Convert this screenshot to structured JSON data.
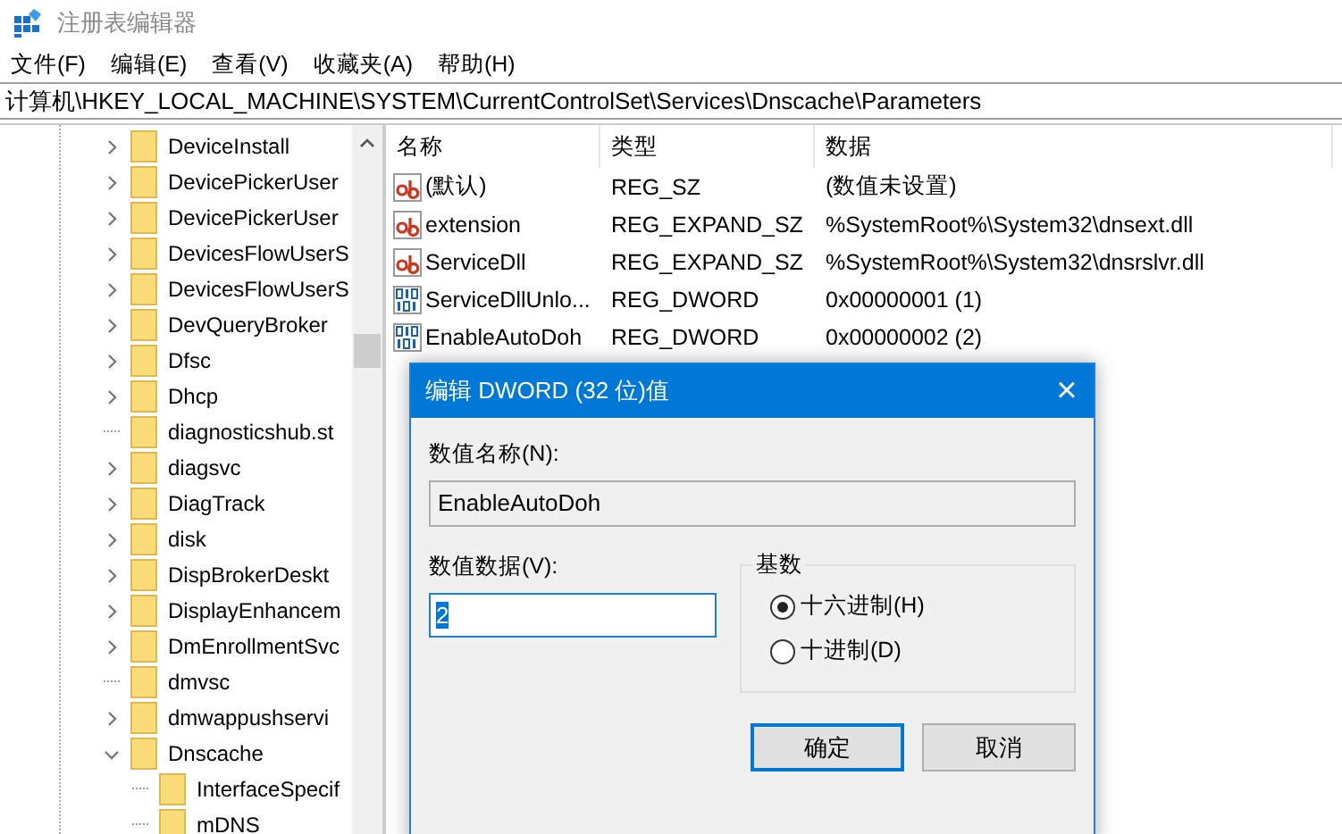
{
  "window": {
    "title": "注册表编辑器"
  },
  "menu": [
    "文件(F)",
    "编辑(E)",
    "查看(V)",
    "收藏夹(A)",
    "帮助(H)"
  ],
  "address": "计算机\\HKEY_LOCAL_MACHINE\\SYSTEM\\CurrentControlSet\\Services\\Dnscache\\Parameters",
  "tree": [
    {
      "label": "DeviceInstall",
      "expandable": true,
      "expanded": false
    },
    {
      "label": "DevicePickerUser",
      "expandable": true,
      "expanded": false
    },
    {
      "label": "DevicePickerUser",
      "expandable": true,
      "expanded": false
    },
    {
      "label": "DevicesFlowUserS",
      "expandable": true,
      "expanded": false
    },
    {
      "label": "DevicesFlowUserS",
      "expandable": true,
      "expanded": false
    },
    {
      "label": "DevQueryBroker",
      "expandable": true,
      "expanded": false
    },
    {
      "label": "Dfsc",
      "expandable": true,
      "expanded": false
    },
    {
      "label": "Dhcp",
      "expandable": true,
      "expanded": false
    },
    {
      "label": "diagnosticshub.st",
      "expandable": false,
      "expanded": false
    },
    {
      "label": "diagsvc",
      "expandable": true,
      "expanded": false
    },
    {
      "label": "DiagTrack",
      "expandable": true,
      "expanded": false
    },
    {
      "label": "disk",
      "expandable": true,
      "expanded": false
    },
    {
      "label": "DispBrokerDeskt",
      "expandable": true,
      "expanded": false
    },
    {
      "label": "DisplayEnhancem",
      "expandable": true,
      "expanded": false
    },
    {
      "label": "DmEnrollmentSvc",
      "expandable": true,
      "expanded": false
    },
    {
      "label": "dmvsc",
      "expandable": false,
      "expanded": false
    },
    {
      "label": "dmwappushservi",
      "expandable": true,
      "expanded": false
    },
    {
      "label": "Dnscache",
      "expandable": true,
      "expanded": true,
      "children": [
        {
          "label": "InterfaceSpecif",
          "expandable": false,
          "expanded": false
        },
        {
          "label": "mDNS",
          "expandable": false,
          "expanded": false
        }
      ]
    }
  ],
  "table": {
    "columns": [
      "名称",
      "类型",
      "数据"
    ],
    "rows": [
      {
        "kind": "string",
        "name": "(默认)",
        "type": "REG_SZ",
        "data": "(数值未设置)"
      },
      {
        "kind": "string",
        "name": "extension",
        "type": "REG_EXPAND_SZ",
        "data": "%SystemRoot%\\System32\\dnsext.dll"
      },
      {
        "kind": "string",
        "name": "ServiceDll",
        "type": "REG_EXPAND_SZ",
        "data": "%SystemRoot%\\System32\\dnsrslvr.dll"
      },
      {
        "kind": "dword",
        "name": "ServiceDllUnlo...",
        "type": "REG_DWORD",
        "data": "0x00000001 (1)"
      },
      {
        "kind": "dword",
        "name": "EnableAutoDoh",
        "type": "REG_DWORD",
        "data": "0x00000002 (2)"
      }
    ]
  },
  "dialog": {
    "title": "编辑 DWORD (32 位)值",
    "close": "×",
    "name_label": "数值名称(N):",
    "name_value": "EnableAutoDoh",
    "data_label": "数值数据(V):",
    "data_value": "2",
    "base_label": "基数",
    "bases": [
      {
        "label": "十六进制(H)",
        "selected": true
      },
      {
        "label": "十进制(D)",
        "selected": false
      }
    ],
    "buttons": [
      {
        "label": "确定",
        "default": true
      },
      {
        "label": "取消",
        "default": false
      }
    ]
  }
}
